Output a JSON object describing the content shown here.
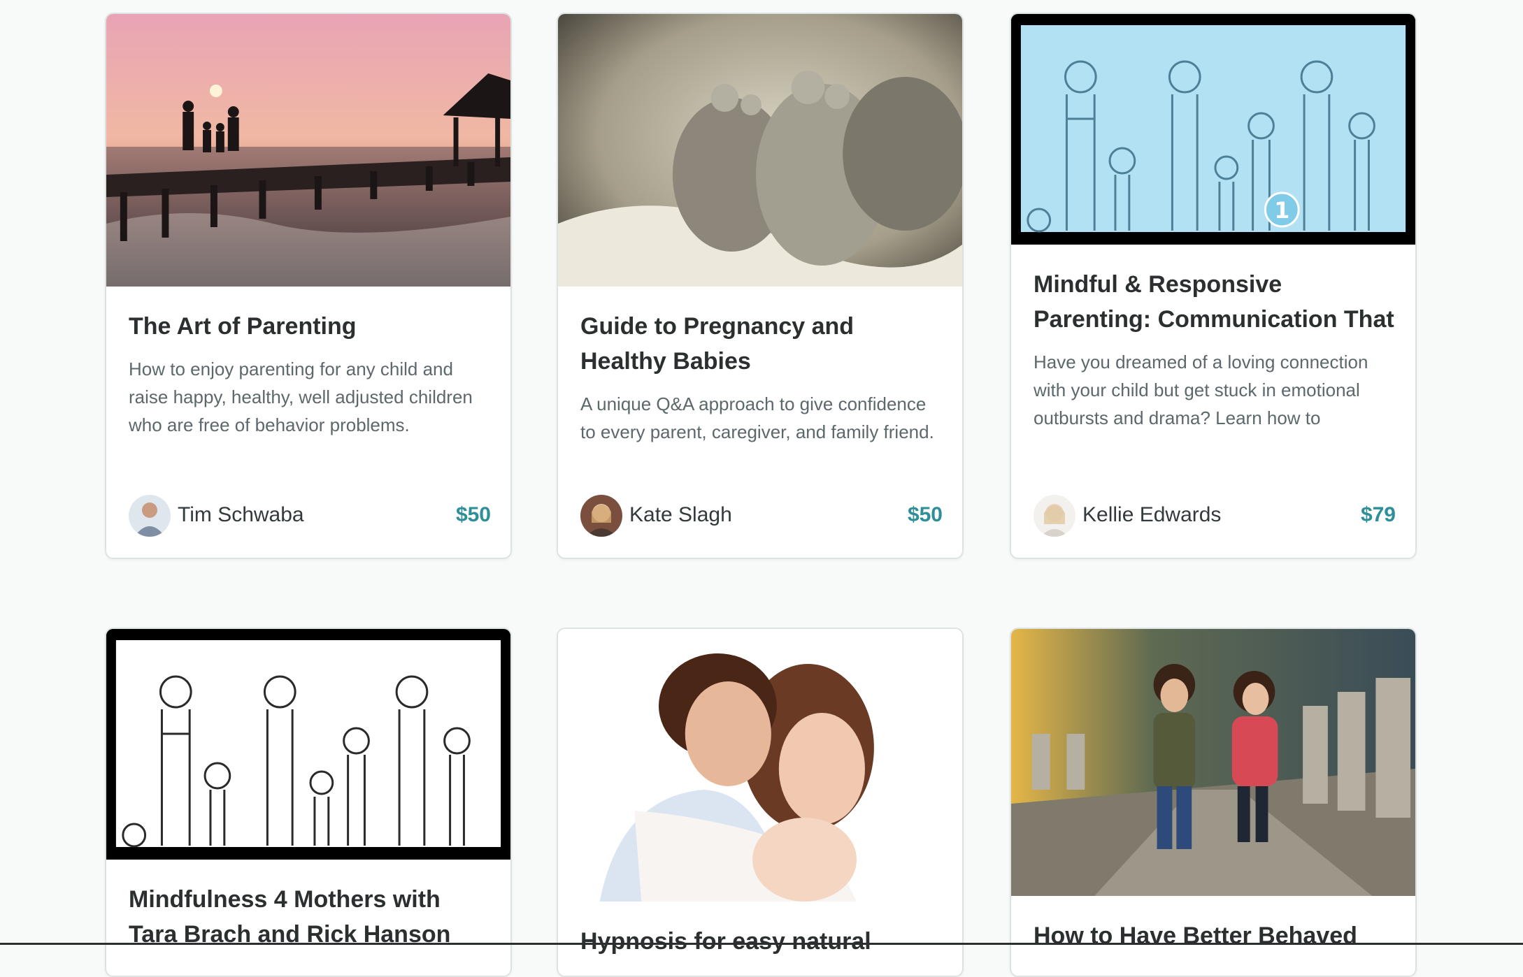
{
  "courses": [
    {
      "title": "The Art of Parenting",
      "description": "How to enjoy parenting for any child and raise happy, healthy, well adjusted children who are free of behavior problems.",
      "author": "Tim Schwaba",
      "price": "$50",
      "image": "family-silhouette-pier-sunset"
    },
    {
      "title": "Guide to Pregnancy and Healthy Babies",
      "description": "A unique Q&A approach to give confidence to every parent, caregiver, and family friend.",
      "author": "Kate Slagh",
      "price": "$50",
      "image": "baby-feet-photo"
    },
    {
      "title": "Mindful & Responsive Parenting: Communication That",
      "description": "Have you dreamed of a loving connection with your child but get stuck in emotional outbursts and drama? Learn how to",
      "author": "Kellie Edwards",
      "price": "$79",
      "image": "cartoon-family-blue",
      "badge": "1"
    },
    {
      "title": "Mindfulness 4 Mothers with Tara Brach and Rick Hanson",
      "image": "cartoon-family-sketch"
    },
    {
      "title": "Hypnosis for easy natural",
      "image": "parents-with-baby-photo"
    },
    {
      "title": "How to Have Better Behaved",
      "image": "children-on-path-photo"
    }
  ],
  "colors": {
    "page_bg": "#f8f9f9",
    "price": "#2e8f98",
    "title": "#2b2f30",
    "description": "#5d686b"
  }
}
